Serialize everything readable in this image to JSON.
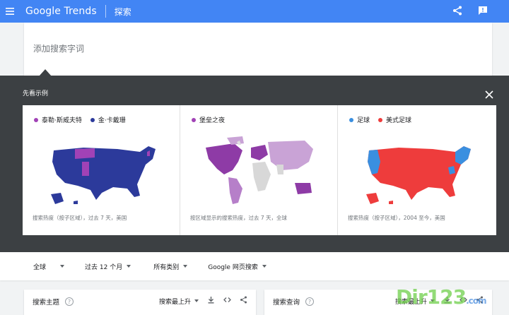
{
  "app": {
    "brand": "Google Trends",
    "page_title": "探索"
  },
  "search": {
    "placeholder": "添加搜索字词"
  },
  "examples": {
    "title": "先看示例",
    "cards": [
      {
        "legend": [
          {
            "label": "泰勒·斯威夫特",
            "color": "#a142b6"
          },
          {
            "label": "金·卡戴珊",
            "color": "#2c3a9b"
          }
        ],
        "caption": "搜索热度（按子区域），过去 7 天，美国"
      },
      {
        "legend": [
          {
            "label": "堡垒之夜",
            "color": "#a142b6"
          }
        ],
        "caption": "按区域显示的搜索热度，过去 7 天，全球"
      },
      {
        "legend": [
          {
            "label": "足球",
            "color": "#3a8fe0"
          },
          {
            "label": "美式足球",
            "color": "#ee3c3c"
          }
        ],
        "caption": "搜索热度（按子区域），2004 至今，美国"
      }
    ]
  },
  "filters": {
    "region": "全球",
    "time": "过去 12 个月",
    "category": "所有类别",
    "search_type": "Google 网页搜索"
  },
  "panels": {
    "left": {
      "title": "搜索主题",
      "sort": "搜索最上升"
    },
    "right": {
      "title": "搜索查询",
      "sort": "搜索最上升"
    }
  },
  "watermark": {
    "main": "Dir123",
    "suffix": ".com"
  },
  "colors": {
    "accent": "#4285f4",
    "dark_panel": "#3c4043",
    "purple": "#a142b6",
    "navy": "#2c3a9b",
    "blue": "#3a8fe0",
    "red": "#ee3c3c"
  }
}
